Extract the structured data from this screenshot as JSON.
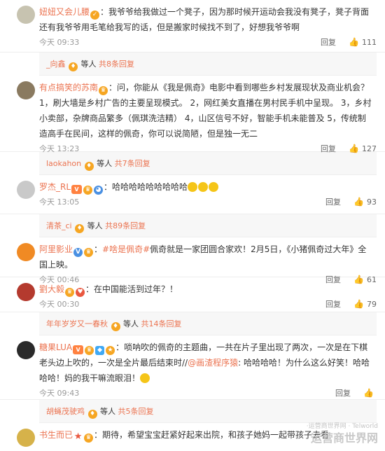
{
  "comments": [
    {
      "user": "妞妞又会儿腰",
      "text": "：我爷爷给我做过一个凳子，因为那时候开运动会我没有凳子，凳子背面还有我爷爷用毛笔给我写的话，但是搬家时候找不到了，好想我爷爷啊",
      "time": "今天 09:33",
      "reply": "回复",
      "likes": "111",
      "avatar_color": "#c7c3b0"
    },
    {
      "user": "有点搞笑的苏南",
      "text": "：问，你能从《我是佩奇》电影中看到哪些乡村发展现状及商业机会？ 1，刷大墙是乡村广告的主要呈现模式。 2，网红美女直播在男村民手机中呈现。 3，乡村小卖部，杂牌商品繁多（佩琪洗洁精） 4，山区信号不好，智能手机未能普及 5，传统制造高手在民间，这样的佩奇，你可以说简陋，但是独一无二",
      "time": "今天 13:23",
      "reply": "回复",
      "likes": "127",
      "avatar_color": "#8a7a60"
    },
    {
      "user": "罗杰_RL",
      "text": "：哈哈哈哈哈哈哈哈哈",
      "time": "今天 13:05",
      "reply": "回复",
      "likes": "93",
      "avatar_color": "#c9c9c9"
    },
    {
      "user": "阿里影业",
      "topic": "#啥是佩奇#",
      "text": "佩奇就是一家团圆合家欢！2月5日，《小猪佩奇过大年》全国上映。",
      "time": "今天 00:46",
      "reply": "回复",
      "likes": "61",
      "avatar_color": "#f08a24"
    },
    {
      "user": "劉大毅",
      "text": "：在中国能活到过年？！",
      "time": "今天 00:30",
      "reply": "回复",
      "likes": "79",
      "avatar_color": "#b43a2e"
    },
    {
      "user": "糖果LUA",
      "text_a": "：唢呐吹的佩奇的主题曲，一共在片子里出现了两次，一次是在下棋老头边上吹的，一次是全片最后结束时//",
      "mention": "@画渣程序猿",
      "text_b": ": 哈哈哈哈！为什么这么好笑！哈哈哈哈！妈的我干嘛流眼泪！",
      "time": "今天 09:43",
      "reply": "回复",
      "likes": "",
      "avatar_color": "#2a2a2a"
    },
    {
      "user": "书生而已",
      "text": "：期待，希望宝宝赶紧好起来出院，和孩子她妈一起带孩子去看",
      "avatar_color": "#d6b24a"
    }
  ],
  "reply_threads": [
    {
      "name": "_向鑫",
      "etc": "等人",
      "count": "共8条回复"
    },
    {
      "name": "laokahon",
      "etc": "等人",
      "count": "共7条回复"
    },
    {
      "name": "清茶_ci",
      "etc": "等人",
      "count": "共89条回复"
    },
    {
      "name": "年年岁岁又一春秋",
      "etc": "等人",
      "count": "共14条回复"
    },
    {
      "name": "胡蝇茂驶鸡",
      "etc": "等人",
      "count": "共5条回复"
    }
  ],
  "watermark": {
    "small": "·运营商世界网 · Telworld",
    "big": "运营商世界网"
  }
}
